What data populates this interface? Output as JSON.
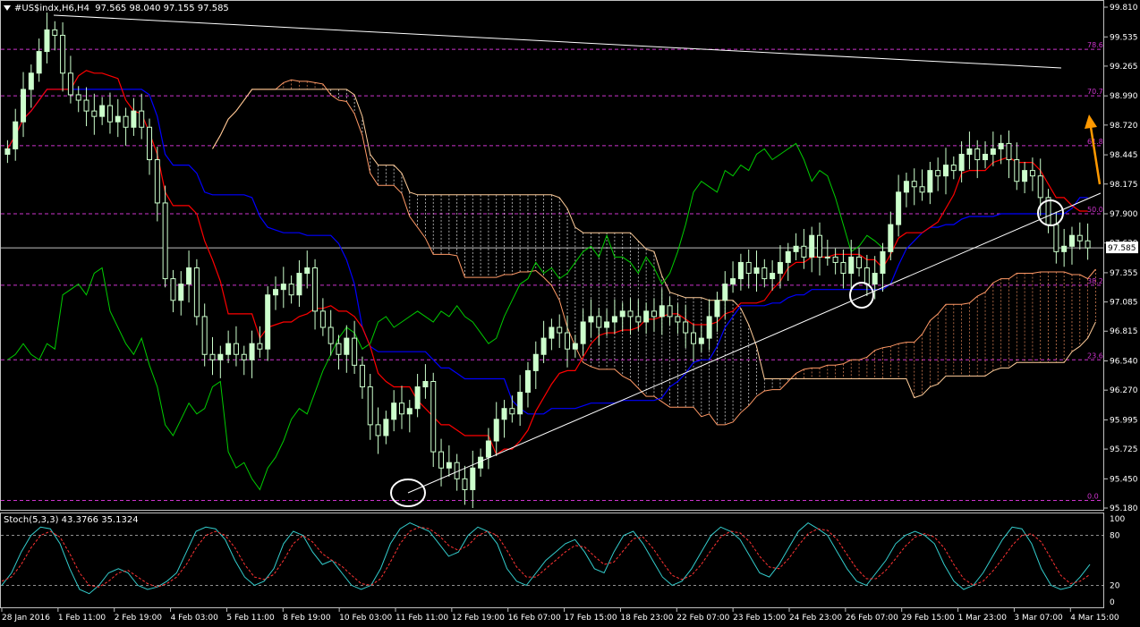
{
  "header": {
    "symbol": "#US$indx",
    "timeframe": "H6,H4",
    "ohlc": "97.565 98.040 97.155 97.585"
  },
  "stoch_header": {
    "label": "Stoch(5,3,3)",
    "values": "43.3766 35.1324"
  },
  "current_price_label": "97.585",
  "colors": {
    "background": "#000000",
    "bull_candle": "#ccffcc",
    "tenkan": "#ff0000",
    "kijun": "#0000ff",
    "chikou": "#00cc00",
    "senkou_a": "#ff9966",
    "senkou_b": "#ffffff",
    "fib_lines": "#cc33cc",
    "trendline": "#ffffff",
    "arrow": "#ff9900",
    "stoch_main": "#33cccc",
    "stoch_signal": "#ff3333"
  },
  "chart_data": [
    {
      "type": "candlestick",
      "title": "#US$indx,H6,H4",
      "ylim": [
        95.18,
        99.81
      ],
      "y_ticks": [
        "99.810",
        "99.535",
        "99.265",
        "98.990",
        "98.720",
        "98.445",
        "98.175",
        "97.900",
        "97.630",
        "97.355",
        "97.085",
        "96.815",
        "96.540",
        "96.270",
        "95.995",
        "95.725",
        "95.450",
        "95.180"
      ],
      "x_labels": [
        "28 Jan 2016",
        "1 Feb 11:00",
        "2 Feb 19:00",
        "4 Feb 03:00",
        "5 Feb 11:00",
        "8 Feb 19:00",
        "10 Feb 03:00",
        "11 Feb 11:00",
        "12 Feb 19:00",
        "16 Feb 07:00",
        "17 Feb 15:00",
        "18 Feb 23:00",
        "22 Feb 07:00",
        "23 Feb 15:00",
        "24 Feb 23:00",
        "26 Feb 07:00",
        "29 Feb 15:00",
        "1 Mar 23:00",
        "3 Mar 07:00",
        "4 Mar 15:00"
      ],
      "fib_levels": [
        {
          "label": "78.6",
          "value": 99.42
        },
        {
          "label": "70.7",
          "value": 98.99
        },
        {
          "label": "61.8",
          "value": 98.53
        },
        {
          "label": "50.0",
          "value": 97.9
        },
        {
          "label": "38.2",
          "value": 97.24
        },
        {
          "label": "23.6",
          "value": 96.55
        },
        {
          "label": "0.0",
          "value": 95.25
        }
      ],
      "horizontal_price_line": 97.585,
      "close_series": [
        98.5,
        98.75,
        99.05,
        99.2,
        99.4,
        99.6,
        99.55,
        99.2,
        99.0,
        98.95,
        98.85,
        98.8,
        98.9,
        98.75,
        98.8,
        98.7,
        98.85,
        98.7,
        98.4,
        98.0,
        97.3,
        97.1,
        97.25,
        97.4,
        96.95,
        96.6,
        96.55,
        96.6,
        96.7,
        96.6,
        96.55,
        96.7,
        96.65,
        97.15,
        97.2,
        97.25,
        97.15,
        97.35,
        97.4,
        97.0,
        96.85,
        96.7,
        96.6,
        96.75,
        96.5,
        96.3,
        95.95,
        95.85,
        96.0,
        96.15,
        96.05,
        96.1,
        96.3,
        96.35,
        95.7,
        95.55,
        95.6,
        95.45,
        95.35,
        95.55,
        95.65,
        95.8,
        96.0,
        96.1,
        96.05,
        96.25,
        96.45,
        96.6,
        96.75,
        96.85,
        96.8,
        96.65,
        96.7,
        96.9,
        96.95,
        96.85,
        96.9,
        96.95,
        97.0,
        96.95,
        96.9,
        97.0,
        96.95,
        97.05,
        96.95,
        96.9,
        96.8,
        96.7,
        96.75,
        96.95,
        97.1,
        97.25,
        97.3,
        97.45,
        97.35,
        97.4,
        97.3,
        97.35,
        97.45,
        97.55,
        97.6,
        97.5,
        97.7,
        97.5,
        97.5,
        97.45,
        97.35,
        97.5,
        97.4,
        97.25,
        97.35,
        97.55,
        97.8,
        98.1,
        98.2,
        98.15,
        98.1,
        98.3,
        98.25,
        98.35,
        98.3,
        98.45,
        98.5,
        98.4,
        98.45,
        98.5,
        98.55,
        98.4,
        98.2,
        98.3,
        98.25,
        98.05,
        97.8,
        97.55,
        97.6,
        97.7,
        97.65,
        97.585
      ]
    },
    {
      "type": "line",
      "title": "Stoch(5,3,3)",
      "ylim": [
        0,
        100
      ],
      "y_ticks": [
        "100",
        "80",
        "20",
        "0"
      ],
      "levels": [
        80,
        20
      ],
      "main_value": 43.3766,
      "signal_value": 35.1324,
      "main": [
        20,
        35,
        60,
        80,
        90,
        88,
        70,
        40,
        15,
        10,
        20,
        35,
        40,
        35,
        20,
        15,
        18,
        25,
        35,
        60,
        85,
        90,
        88,
        75,
        50,
        30,
        20,
        25,
        40,
        70,
        85,
        80,
        60,
        45,
        50,
        35,
        20,
        15,
        20,
        40,
        70,
        88,
        95,
        90,
        85,
        70,
        55,
        60,
        80,
        90,
        85,
        70,
        40,
        25,
        20,
        35,
        50,
        60,
        70,
        75,
        60,
        40,
        35,
        60,
        80,
        85,
        70,
        50,
        30,
        20,
        25,
        40,
        60,
        80,
        90,
        85,
        75,
        55,
        35,
        30,
        45,
        65,
        85,
        95,
        88,
        80,
        60,
        40,
        25,
        20,
        35,
        50,
        70,
        80,
        85,
        80,
        70,
        45,
        25,
        15,
        20,
        35,
        55,
        75,
        90,
        88,
        70,
        40,
        20,
        15,
        18,
        30,
        45
      ],
      "signal": [
        25,
        30,
        45,
        65,
        80,
        85,
        78,
        58,
        35,
        20,
        18,
        25,
        35,
        38,
        30,
        22,
        18,
        22,
        30,
        45,
        65,
        80,
        85,
        80,
        65,
        45,
        30,
        27,
        33,
        50,
        70,
        80,
        72,
        58,
        50,
        43,
        32,
        22,
        20,
        28,
        48,
        70,
        85,
        90,
        88,
        80,
        68,
        62,
        68,
        80,
        85,
        80,
        62,
        42,
        30,
        30,
        40,
        50,
        60,
        68,
        66,
        55,
        45,
        48,
        62,
        76,
        78,
        65,
        48,
        32,
        27,
        32,
        45,
        62,
        78,
        85,
        83,
        72,
        55,
        42,
        40,
        52,
        68,
        82,
        88,
        86,
        75,
        57,
        40,
        28,
        28,
        38,
        52,
        67,
        78,
        82,
        78,
        65,
        45,
        28,
        20,
        25,
        37,
        52,
        68,
        80,
        82,
        72,
        52,
        32,
        22,
        25,
        33
      ]
    }
  ]
}
